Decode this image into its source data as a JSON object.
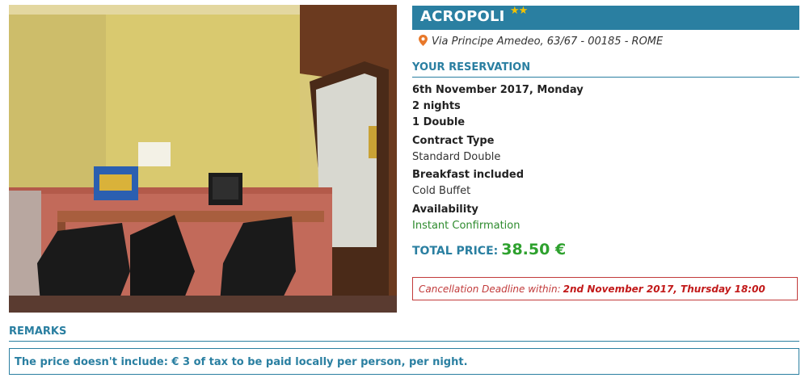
{
  "hotel": {
    "name": "ACROPOLI",
    "stars": "★★",
    "address": "Via Principe Amedeo, 63/67 - 00185 - ROME"
  },
  "reservation": {
    "title": "YOUR RESERVATION",
    "date": "6th November 2017, Monday",
    "nights": "2 nights",
    "room": "1 Double",
    "contract_label": "Contract Type",
    "contract_value": "Standard Double",
    "board_label": "Breakfast included",
    "board_value": "Cold Buffet",
    "availability_label": "Availability",
    "availability_value": "Instant Confirmation",
    "total_label": "TOTAL PRICE:",
    "total_value": "38.50 €"
  },
  "cancellation": {
    "label": "Cancellation Deadline within:",
    "date": "2nd November 2017, Thursday 18:00"
  },
  "remarks": {
    "title": "REMARKS",
    "text": "The price doesn't include: € 3 of tax to be paid locally per person, per night."
  },
  "colors": {
    "accent": "#2a7fa1",
    "price": "#2ea12e",
    "availability": "#2e8b2e",
    "cancel": "#c23b3b",
    "stars": "#f2c200"
  }
}
